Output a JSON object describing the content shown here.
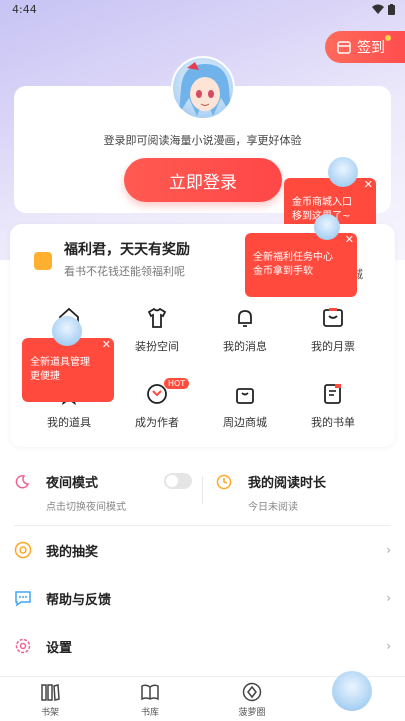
{
  "status_bar": {
    "time": "4:44"
  },
  "signin": {
    "label": "签到"
  },
  "login": {
    "desc": "登录即可阅读海量小说漫画，享更好体验",
    "button": "立即登录"
  },
  "tips": {
    "shop": "金币商城入口\n移到这里了~",
    "welfare": "全新福利任务中心\n金币拿到手软",
    "items": "全新道具管理\n更便捷",
    "close": "✕"
  },
  "welfare": {
    "title": "福利君，天天有奖励",
    "subtitle": "看书不花钱还能领福利呢",
    "right_partial": "币商城"
  },
  "grid": [
    {
      "label": "装扮空间",
      "icon": "tshirt-icon"
    },
    {
      "label": "我的消息",
      "icon": "bell-icon"
    },
    {
      "label": "我的月票",
      "icon": "ticket-icon"
    },
    {
      "label": "我的道具",
      "icon": "star-icon"
    },
    {
      "label": "成为作者",
      "icon": "author-icon",
      "badge": "HOT"
    },
    {
      "label": "周边商城",
      "icon": "bag-icon"
    },
    {
      "label": "我的书单",
      "icon": "booklist-icon"
    }
  ],
  "night": {
    "title": "夜间模式",
    "sub": "点击切换夜间模式"
  },
  "reading": {
    "title": "我的阅读时长",
    "sub": "今日未阅读"
  },
  "menu": [
    {
      "label": "我的抽奖",
      "icon": "lottery-icon"
    },
    {
      "label": "帮助与反馈",
      "icon": "feedback-icon"
    },
    {
      "label": "设置",
      "icon": "settings-icon"
    }
  ],
  "chevron": "›",
  "tabs": [
    {
      "label": "书架"
    },
    {
      "label": "书库"
    },
    {
      "label": "菠萝圈"
    }
  ],
  "colors": {
    "accent": "#ff4a3d",
    "orange": "#ffa726",
    "pink": "#f06292"
  }
}
